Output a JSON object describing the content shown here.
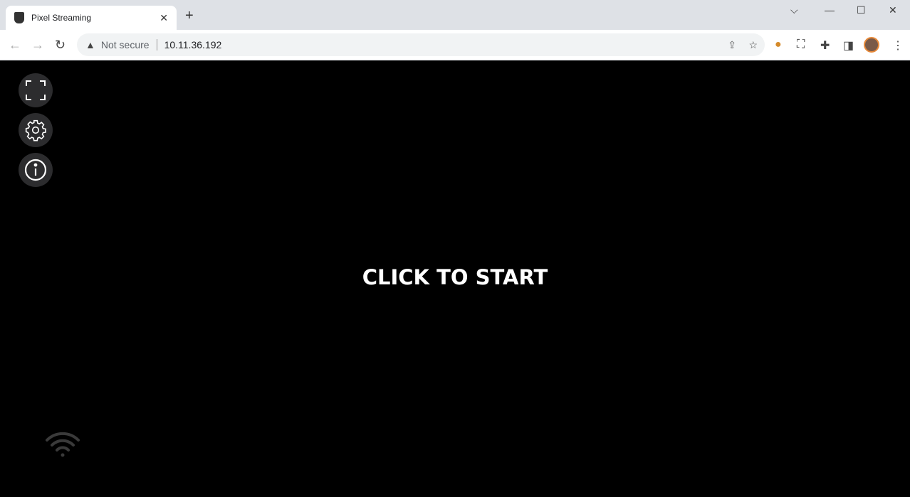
{
  "browser": {
    "tab_title": "Pixel Streaming",
    "security_label": "Not secure",
    "url": "10.11.36.192"
  },
  "icons": [
    "epic-games-favicon",
    "close-icon",
    "plus-icon",
    "chevron-down-icon",
    "minimize-icon",
    "maximize-icon",
    "window-close-icon",
    "back-icon",
    "forward-icon",
    "reload-icon",
    "warning-icon",
    "share-icon",
    "star-icon",
    "cookie-extension-icon",
    "screenshot-extension-icon",
    "extensions-icon",
    "side-panel-icon",
    "profile-avatar",
    "menu-icon",
    "fullscreen-icon",
    "gear-icon",
    "info-icon",
    "wifi-icon"
  ],
  "content": {
    "start_label": "CLICK TO START"
  },
  "colors": {
    "button_bg": "#2c2c2e",
    "wifi": "#3a3a3a",
    "background": "#000000"
  }
}
